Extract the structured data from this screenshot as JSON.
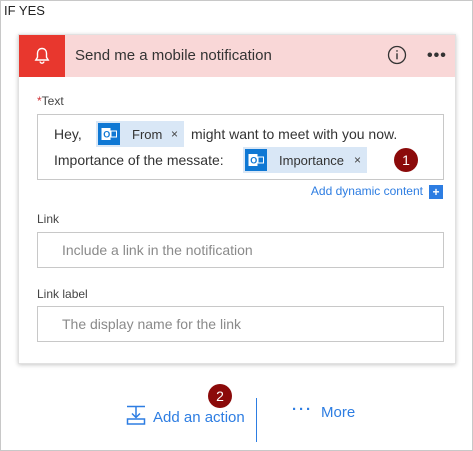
{
  "branch": {
    "label": "IF YES"
  },
  "card": {
    "title": "Send me a mobile notification",
    "header_icon": "bell-icon",
    "info_icon": "info-icon",
    "more_icon": "ellipsis-icon",
    "more_label": "•••",
    "colors": {
      "header_bg": "#f9d7d7",
      "icon_bg": "#e8372e",
      "accent": "#2d7de2",
      "badge": "#8b0a0a"
    }
  },
  "text_field": {
    "required_mark": "*",
    "label": "Text",
    "line1_prefix": "Hey,",
    "token_from": "From",
    "line1_suffix": "might want to meet with you now.",
    "line2_prefix": "Importance of the messate:",
    "token_importance": "Importance",
    "token_close": "×",
    "token_icon": "outlook-icon",
    "add_dynamic": "Add dynamic content",
    "add_dynamic_icon": "+"
  },
  "link_field": {
    "label": "Link",
    "placeholder": "Include a link in the notification"
  },
  "link_label_field": {
    "label": "Link label",
    "placeholder": "The display name for the link"
  },
  "callouts": {
    "one": "1",
    "two": "2"
  },
  "actions": {
    "add_action": "Add an action",
    "add_action_icon": "insert-step-icon",
    "more_dots": "···",
    "more": "More"
  }
}
